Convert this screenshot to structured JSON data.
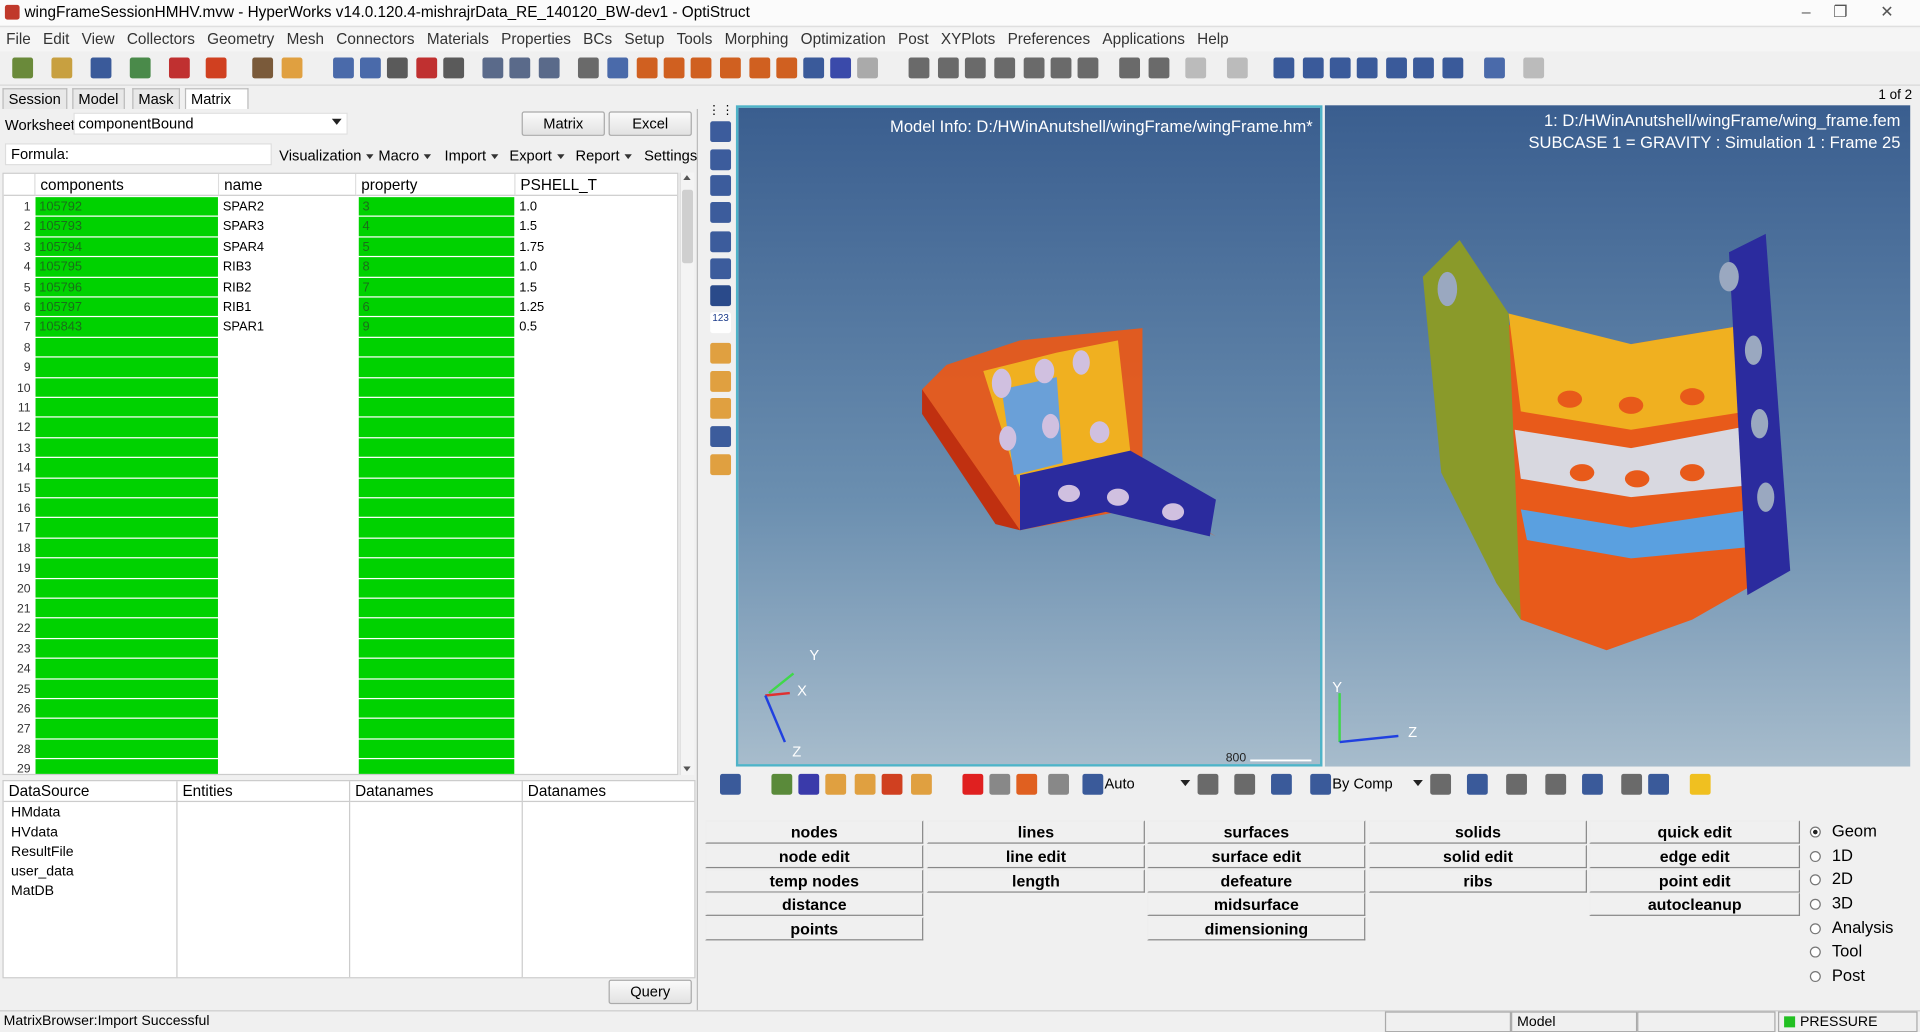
{
  "window": {
    "title": "wingFrameSessionHMHV.mvw - HyperWorks v14.0.120.4-mishrajrData_RE_140120_BW-dev1 - OptiStruct"
  },
  "menu": [
    "File",
    "Edit",
    "View",
    "Collectors",
    "Geometry",
    "Mesh",
    "Connectors",
    "Materials",
    "Properties",
    "BCs",
    "Setup",
    "Tools",
    "Morphing",
    "Optimization",
    "Post",
    "XYPlots",
    "Preferences",
    "Applications",
    "Help"
  ],
  "tabs": [
    "Session",
    "Model",
    "Mask",
    "Matrix"
  ],
  "tab_close": "×",
  "matrix": {
    "worksheet_label": "Worksheet:",
    "worksheet_value": "componentBound",
    "matrix_btn": "Matrix",
    "excel_btn": "Excel",
    "formula_label": "Formula:",
    "menus": [
      "Visualization",
      "Macro",
      "Import",
      "Export",
      "Report",
      "Settings"
    ]
  },
  "grid": {
    "headers": [
      "components",
      "name",
      "property",
      "PSHELL_T"
    ],
    "rows": [
      [
        "105792",
        "SPAR2",
        "3",
        "1.0"
      ],
      [
        "105793",
        "SPAR3",
        "4",
        "1.5"
      ],
      [
        "105794",
        "SPAR4",
        "5",
        "1.75"
      ],
      [
        "105795",
        "RIB3",
        "8",
        "1.0"
      ],
      [
        "105796",
        "RIB2",
        "7",
        "1.5"
      ],
      [
        "105797",
        "RIB1",
        "6",
        "1.25"
      ],
      [
        "105843",
        "SPAR1",
        "9",
        "0.5"
      ]
    ],
    "row_numbers": [
      "1",
      "2",
      "3",
      "4",
      "5",
      "6",
      "7",
      "8",
      "9",
      "10",
      "11",
      "12",
      "13",
      "14",
      "15",
      "16",
      "17",
      "18",
      "19",
      "20",
      "21",
      "22",
      "23",
      "24",
      "25",
      "26",
      "27",
      "28",
      "29"
    ]
  },
  "datasource": {
    "headers": [
      "DataSource",
      "Entities",
      "Datanames",
      "Datanames"
    ],
    "items": [
      "HMdata",
      "HVdata",
      "ResultFile",
      "user_data",
      "MatDB"
    ],
    "query_btn": "Query"
  },
  "viewport1": {
    "model_info": "Model Info: D:/HWinAnutshell/wingFrame/wingFrame.hm*",
    "scale": "800",
    "axes": [
      "Y",
      "X",
      "Z"
    ]
  },
  "viewport2": {
    "page": "1 of 2",
    "file": "1: D:/HWinAnutshell/wingFrame/wing_frame.fem",
    "subcase": "SUBCASE 1 = GRAVITY   : Simulation 1 : Frame 25",
    "axes": [
      "Y",
      "Z"
    ]
  },
  "panel_toolbar": {
    "auto": "Auto",
    "bycomp": "By Comp"
  },
  "panel": {
    "col1": [
      "nodes",
      "node edit",
      "temp nodes",
      "distance",
      "points"
    ],
    "col2": [
      "lines",
      "line edit",
      "length"
    ],
    "col3": [
      "surfaces",
      "surface edit",
      "defeature",
      "midsurface",
      "dimensioning"
    ],
    "col4": [
      "solids",
      "solid edit",
      "ribs"
    ],
    "col5": [
      "quick edit",
      "edge edit",
      "point edit",
      "autocleanup"
    ],
    "radios": [
      "Geom",
      "1D",
      "2D",
      "3D",
      "Analysis",
      "Tool",
      "Post"
    ]
  },
  "status": {
    "message": "MatrixBrowser:Import Successful",
    "model": "Model",
    "pressure": "PRESSURE"
  },
  "colors": {
    "green": "#00d200",
    "orange": "#e85a1a",
    "yellow": "#f0b020",
    "blue": "#2b2b9e",
    "olive": "#8a9a2a"
  }
}
